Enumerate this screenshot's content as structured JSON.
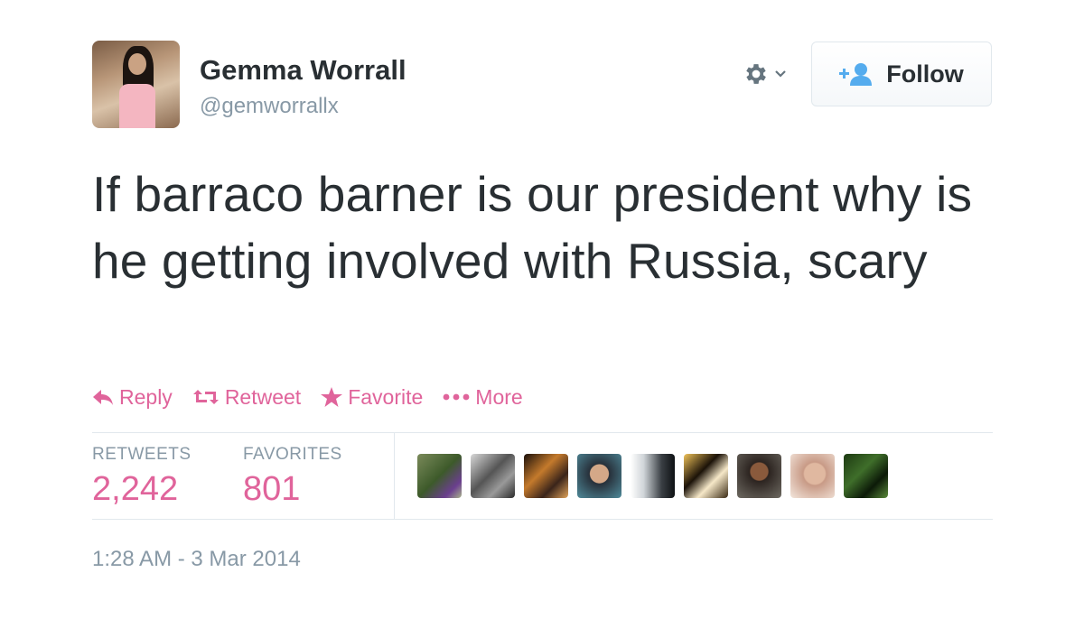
{
  "user": {
    "name": "Gemma Worrall",
    "handle": "@gemworrallx"
  },
  "follow_button": {
    "label": "Follow",
    "icon": "add-user-icon"
  },
  "settings_menu": {
    "icon": "gear-icon"
  },
  "tweet": {
    "text": "If barraco barner is our president why is he getting involved with Russia, scary"
  },
  "actions": [
    {
      "label": "Reply",
      "icon": "reply-icon"
    },
    {
      "label": "Retweet",
      "icon": "retweet-icon"
    },
    {
      "label": "Favorite",
      "icon": "star-icon"
    },
    {
      "label": "More",
      "icon": "more-dots-icon"
    }
  ],
  "stats": {
    "retweets_label": "RETWEETS",
    "retweets_value": "2,242",
    "favorites_label": "FAVORITES",
    "favorites_value": "801"
  },
  "favoriters_count_shown": 9,
  "timestamp": "1:28 AM - 3 Mar 2014",
  "colors": {
    "accent": "#e0649b",
    "text": "#292f33",
    "muted": "#8899a6",
    "follow_icon": "#55acee",
    "border": "#e1e8ed"
  }
}
